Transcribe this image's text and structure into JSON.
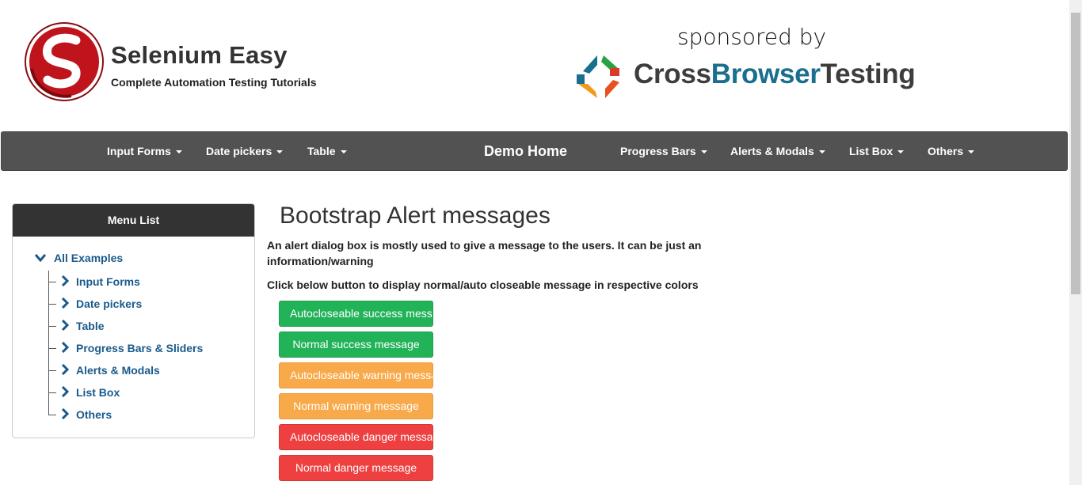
{
  "brand": {
    "title": "Selenium Easy",
    "subtitle": "Complete Automation Testing Tutorials",
    "logo_icon": "selenium-easy-logo-icon",
    "colors": {
      "logo_red": "#c0141c",
      "logo_dark": "#7a0a0e"
    }
  },
  "sponsor": {
    "label": "sponsored by",
    "name_part1": "Cross",
    "name_part2": "Browser",
    "name_part3": "Testing",
    "logo_icon": "crossbrowsertesting-logo-icon",
    "colors": {
      "accent": "#1a6e8e"
    }
  },
  "navbar": {
    "background": "#525252",
    "items": [
      {
        "label": "Input Forms",
        "dropdown": true
      },
      {
        "label": "Date pickers",
        "dropdown": true
      },
      {
        "label": "Table",
        "dropdown": true
      },
      {
        "label": "Demo Home",
        "dropdown": false
      },
      {
        "label": "Progress Bars",
        "dropdown": true
      },
      {
        "label": "Alerts & Modals",
        "dropdown": true
      },
      {
        "label": "List Box",
        "dropdown": true
      },
      {
        "label": "Others",
        "dropdown": true
      }
    ]
  },
  "sidebar": {
    "title": "Menu List",
    "root": {
      "label": "All Examples",
      "icon": "chevron-down-icon"
    },
    "items": [
      {
        "label": "Input Forms",
        "icon": "chevron-right-icon"
      },
      {
        "label": "Date pickers",
        "icon": "chevron-right-icon"
      },
      {
        "label": "Table",
        "icon": "chevron-right-icon"
      },
      {
        "label": "Progress Bars & Sliders",
        "icon": "chevron-right-icon"
      },
      {
        "label": "Alerts & Modals",
        "icon": "chevron-right-icon"
      },
      {
        "label": "List Box",
        "icon": "chevron-right-icon"
      },
      {
        "label": "Others",
        "icon": "chevron-right-icon"
      }
    ]
  },
  "main": {
    "title": "Bootstrap Alert messages",
    "description": "An alert dialog box is mostly used to give a message to the users. It can be just an information/warning",
    "instruction": "Click below button to display normal/auto closeable message in respective colors",
    "buttons": [
      {
        "label": "Autocloseable success message",
        "style": "success"
      },
      {
        "label": "Normal success message",
        "style": "success"
      },
      {
        "label": "Autocloseable warning message",
        "style": "warning"
      },
      {
        "label": "Normal warning message",
        "style": "warning"
      },
      {
        "label": "Autocloseable danger message",
        "style": "danger"
      },
      {
        "label": "Normal danger message",
        "style": "danger"
      }
    ],
    "colors": {
      "success": "#22b359",
      "warning": "#f8a94a",
      "danger": "#ee4040"
    }
  }
}
